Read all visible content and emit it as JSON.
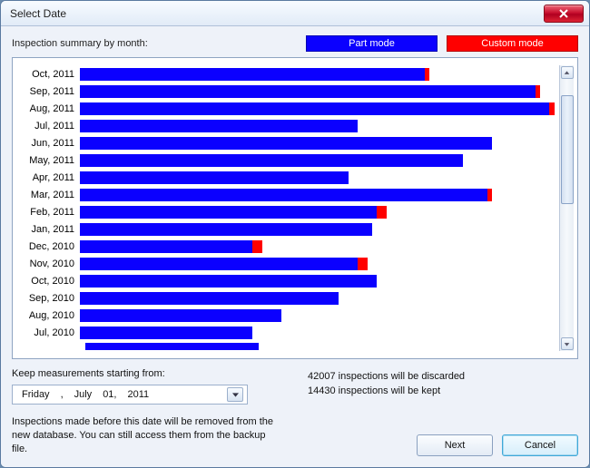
{
  "window": {
    "title": "Select Date"
  },
  "modes": {
    "summary_label": "Inspection summary by month:",
    "part": "Part mode",
    "custom": "Custom mode"
  },
  "chart_data": {
    "type": "bar",
    "orientation": "horizontal",
    "title": "Inspection summary by month",
    "xlabel": "",
    "ylabel": "",
    "xlim": [
      0,
      100
    ],
    "categories": [
      "Oct, 2011",
      "Sep, 2011",
      "Aug, 2011",
      "Jul, 2011",
      "Jun, 2011",
      "May, 2011",
      "Apr, 2011",
      "Mar, 2011",
      "Feb, 2011",
      "Jan, 2011",
      "Dec, 2010",
      "Nov, 2010",
      "Oct, 2010",
      "Sep, 2010",
      "Aug, 2010",
      "Jul, 2010"
    ],
    "series": [
      {
        "name": "Part mode",
        "color": "#0b00ff",
        "values": [
          72,
          95,
          98,
          58,
          86,
          80,
          56,
          85,
          62,
          61,
          36,
          58,
          62,
          54,
          42,
          36
        ]
      },
      {
        "name": "Custom mode",
        "color": "#ff0000",
        "values": [
          1,
          1,
          1,
          0,
          0,
          0,
          0,
          1,
          2,
          0,
          2,
          2,
          0,
          0,
          0,
          0
        ]
      }
    ],
    "partial_next_row_blue": 32
  },
  "keep": {
    "label": "Keep measurements starting from:",
    "weekday": "Friday",
    "sep": ",",
    "month": "July",
    "day": "01,",
    "year": "2011"
  },
  "status": {
    "discarded": "42007 inspections will be discarded",
    "kept": "14430 inspections will be kept"
  },
  "info": "Inspections made before this date will be removed from the new database. You can still access them from the backup file.",
  "buttons": {
    "next": "Next",
    "cancel": "Cancel"
  }
}
